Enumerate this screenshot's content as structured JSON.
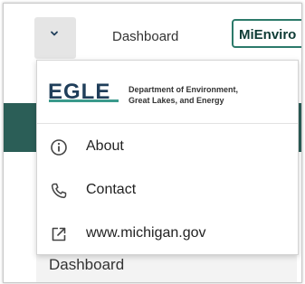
{
  "topbar": {
    "menu_toggle_icon": "chevron-down-icon",
    "dashboard_label": "Dashboard",
    "mienviro_label": "MiEnviro"
  },
  "dropdown": {
    "brand": {
      "logo_text": "EGLE",
      "department_line1": "Department of Environment,",
      "department_line2": "Great Lakes, and Energy"
    },
    "items": [
      {
        "label": "About",
        "icon": "info-icon"
      },
      {
        "label": "Contact",
        "icon": "phone-icon"
      },
      {
        "label": "www.michigan.gov",
        "icon": "external-link-icon"
      }
    ]
  },
  "sidebar": {
    "dashboard_label": "Dashboard"
  },
  "colors": {
    "accent_green": "#2c7a6a",
    "dark_green": "#2b5e57",
    "logo_blue": "#1f3e5a",
    "logo_teal": "#3a9a8c"
  }
}
